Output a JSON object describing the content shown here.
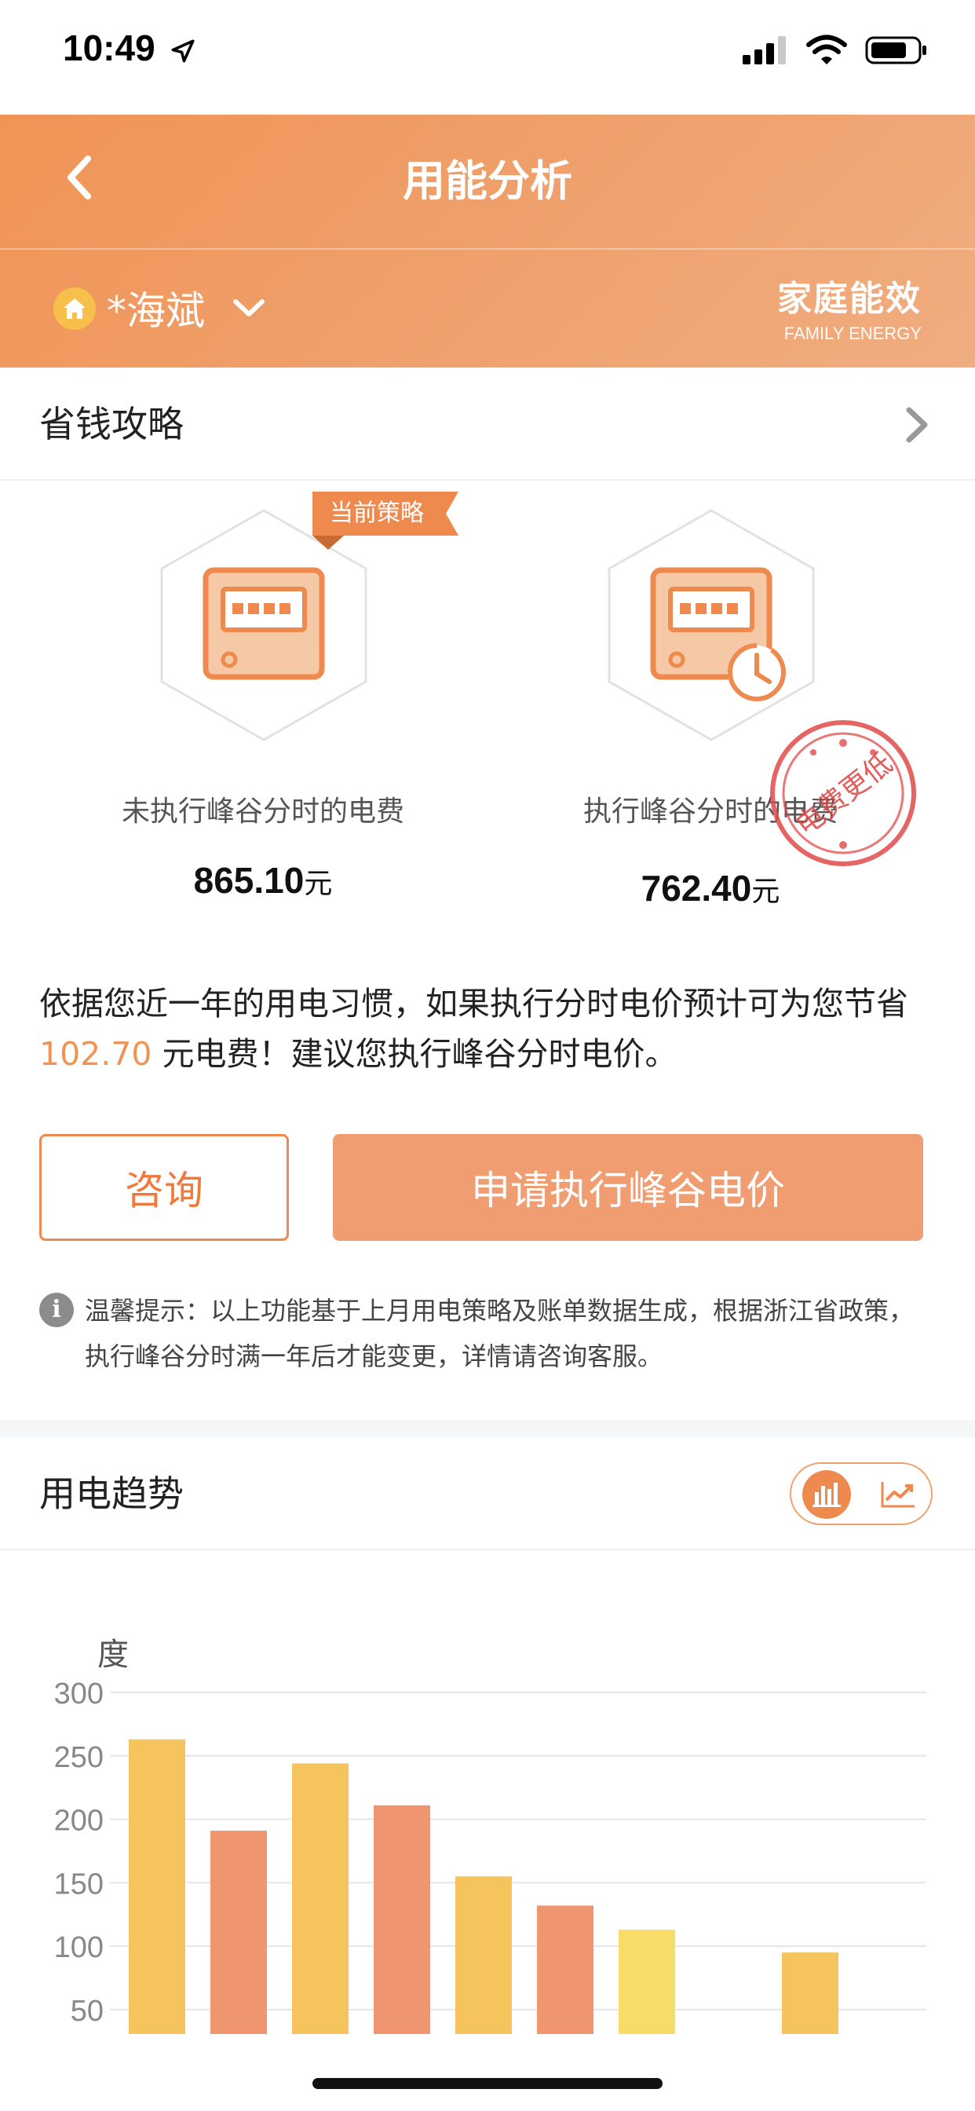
{
  "status_bar": {
    "time": "10:49"
  },
  "header": {
    "title": "用能分析",
    "account_name": "*海斌",
    "brand_cn": "家庭能效",
    "brand_en": "FAMILY ENERGY"
  },
  "colors": {
    "accent": "#ef8a4f",
    "header_gradient_start": "#f09456",
    "bar_yellow": "#f5c45d",
    "bar_orange": "#ef9570",
    "bar_light_yellow": "#f7dc6a"
  },
  "strategy": {
    "section_title": "省钱攻略",
    "current_tag": "当前策略",
    "left": {
      "label": "未执行峰谷分时的电费",
      "value": "865.10",
      "unit": "元",
      "icon": "electric-meter-icon"
    },
    "right": {
      "label": "执行峰谷分时的电费",
      "value": "762.40",
      "unit": "元",
      "icon": "electric-meter-clock-icon"
    },
    "stamp_text": "电费更低",
    "savings_before": "依据您近一年的用电习惯，如果执行分时电价预计可为您节省 ",
    "savings_amount": "102.70",
    "savings_after": " 元电费！建议您执行峰谷分时电价。",
    "consult_label": "咨询",
    "apply_label": "申请执行峰谷电价",
    "tip": "温馨提示：以上功能基于上月用电策略及账单数据生成，根据浙江省政策，执行峰谷分时满一年后才能变更，详情请咨询客服。"
  },
  "trend": {
    "section_title": "用电趋势",
    "toggle_options": [
      "bar-chart-icon",
      "line-chart-icon"
    ],
    "active_toggle": "bar-chart-icon"
  },
  "chart_data": {
    "type": "bar",
    "ylabel": "度",
    "yticks": [
      300,
      250,
      200,
      150,
      100,
      50
    ],
    "ylim": [
      40,
      300
    ],
    "grid": true,
    "values": [
      263,
      191,
      244,
      211,
      155,
      132,
      113,
      null,
      95
    ],
    "colors": [
      "#f5c45d",
      "#ef9570",
      "#f5c45d",
      "#ef9570",
      "#f5c45d",
      "#ef9570",
      "#f7dc6a",
      null,
      "#f5c45d"
    ]
  }
}
